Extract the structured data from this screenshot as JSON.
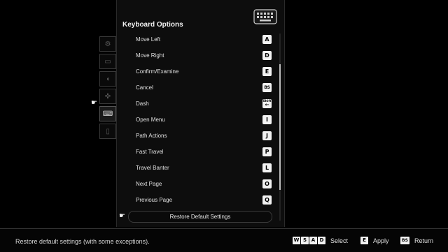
{
  "header": {
    "title": "Keyboard Options",
    "keyboard_icon": "keyboard-icon"
  },
  "side_tabs": [
    {
      "icon": "wrench-icon",
      "glyph": "⚙"
    },
    {
      "icon": "monitor-icon",
      "glyph": "▭"
    },
    {
      "icon": "speaker-icon",
      "glyph": "◖"
    },
    {
      "icon": "gamepad-icon",
      "glyph": "✜"
    },
    {
      "icon": "keyboard-icon",
      "glyph": "⌨"
    },
    {
      "icon": "mouse-icon",
      "glyph": "▯"
    }
  ],
  "bindings": [
    {
      "label": "Move Left",
      "key": "A"
    },
    {
      "label": "Move Right",
      "key": "D"
    },
    {
      "label": "Confirm/Examine",
      "key": "E"
    },
    {
      "label": "Cancel",
      "key": "BS"
    },
    {
      "label": "Dash",
      "key_line1": "Shift",
      "key_line2": "←"
    },
    {
      "label": "Open Menu",
      "key": "I"
    },
    {
      "label": "Path Actions",
      "key": "J"
    },
    {
      "label": "Fast Travel",
      "key": "P"
    },
    {
      "label": "Travel Banter",
      "key": "L"
    },
    {
      "label": "Next Page",
      "key": "O"
    },
    {
      "label": "Previous Page",
      "key": "Q"
    }
  ],
  "restore_button": {
    "label": "Restore Default Settings"
  },
  "footer": {
    "description": "Restore default settings (with some exceptions).",
    "select_keys": [
      "W",
      "S",
      "A",
      "D"
    ],
    "select_label": "Select",
    "apply_key": "E",
    "apply_label": "Apply",
    "return_key": "BS",
    "return_label": "Return"
  },
  "pointer_glyph": "☛"
}
